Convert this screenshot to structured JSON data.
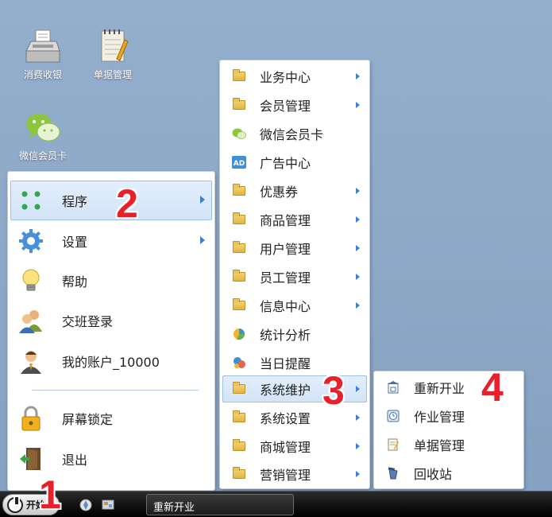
{
  "desktop": {
    "icons": [
      {
        "label": "消费收银",
        "icon": "cash-register-icon"
      },
      {
        "label": "单据管理",
        "icon": "notepad-icon"
      },
      {
        "label": "微信会员卡",
        "icon": "wechat-icon"
      }
    ]
  },
  "start_menu": {
    "items": [
      {
        "label": "程序",
        "icon": "programs-icon",
        "has_submenu": true,
        "active": true
      },
      {
        "label": "设置",
        "icon": "gear-icon",
        "has_submenu": true
      },
      {
        "label": "帮助",
        "icon": "lightbulb-icon"
      },
      {
        "label": "交班登录",
        "icon": "users-icon"
      },
      {
        "label": "我的账户_10000",
        "icon": "account-icon"
      },
      {
        "label": "屏幕锁定",
        "icon": "lock-icon"
      },
      {
        "label": "退出",
        "icon": "exit-door-icon"
      }
    ]
  },
  "programs_menu": {
    "items": [
      {
        "label": "业务中心",
        "icon": "folder-icon",
        "has_submenu": true
      },
      {
        "label": "会员管理",
        "icon": "folder-icon",
        "has_submenu": true
      },
      {
        "label": "微信会员卡",
        "icon": "wechat-icon"
      },
      {
        "label": "广告中心",
        "icon": "ad-icon"
      },
      {
        "label": "优惠券",
        "icon": "folder-icon",
        "has_submenu": true
      },
      {
        "label": "商品管理",
        "icon": "folder-icon",
        "has_submenu": true
      },
      {
        "label": "用户管理",
        "icon": "folder-icon",
        "has_submenu": true
      },
      {
        "label": "员工管理",
        "icon": "folder-icon",
        "has_submenu": true
      },
      {
        "label": "信息中心",
        "icon": "folder-icon",
        "has_submenu": true
      },
      {
        "label": "统计分析",
        "icon": "pie-chart-icon"
      },
      {
        "label": "当日提醒",
        "icon": "reminder-icon"
      },
      {
        "label": "系统维护",
        "icon": "folder-icon",
        "has_submenu": true,
        "active": true
      },
      {
        "label": "系统设置",
        "icon": "folder-icon",
        "has_submenu": true
      },
      {
        "label": "商城管理",
        "icon": "folder-icon",
        "has_submenu": true
      },
      {
        "label": "营销管理",
        "icon": "folder-icon",
        "has_submenu": true
      }
    ]
  },
  "system_menu": {
    "items": [
      {
        "label": "重新开业",
        "icon": "reopen-icon"
      },
      {
        "label": "作业管理",
        "icon": "clock-icon"
      },
      {
        "label": "单据管理",
        "icon": "document-icon"
      },
      {
        "label": "回收站",
        "icon": "recycle-bin-icon"
      }
    ]
  },
  "taskbar": {
    "start_label": "开始",
    "task_label": "重新开业"
  },
  "steps": [
    "1",
    "2",
    "3",
    "4"
  ],
  "colors": {
    "accent": "#3d7fd6",
    "step_marker": "#e8202a",
    "highlight": "#d2e4f7"
  }
}
